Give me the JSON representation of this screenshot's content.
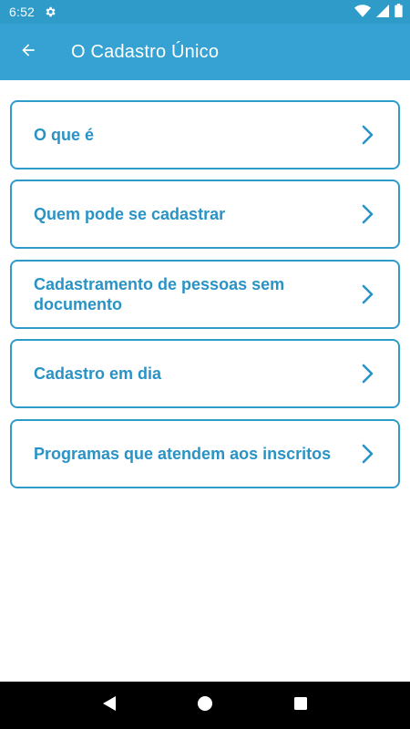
{
  "status_bar": {
    "time": "6:52"
  },
  "app_bar": {
    "title": "O Cadastro Único"
  },
  "menu": {
    "items": [
      {
        "label": "O que é"
      },
      {
        "label": "Quem pode se cadastrar"
      },
      {
        "label": "Cadastramento de pessoas sem documento"
      },
      {
        "label": "Cadastro em dia"
      },
      {
        "label": "Programas que atendem aos inscritos"
      }
    ]
  },
  "colors": {
    "app_bar": "#35a2d3",
    "status_bar": "#2f9bc9",
    "accent": "#2a93c6"
  }
}
